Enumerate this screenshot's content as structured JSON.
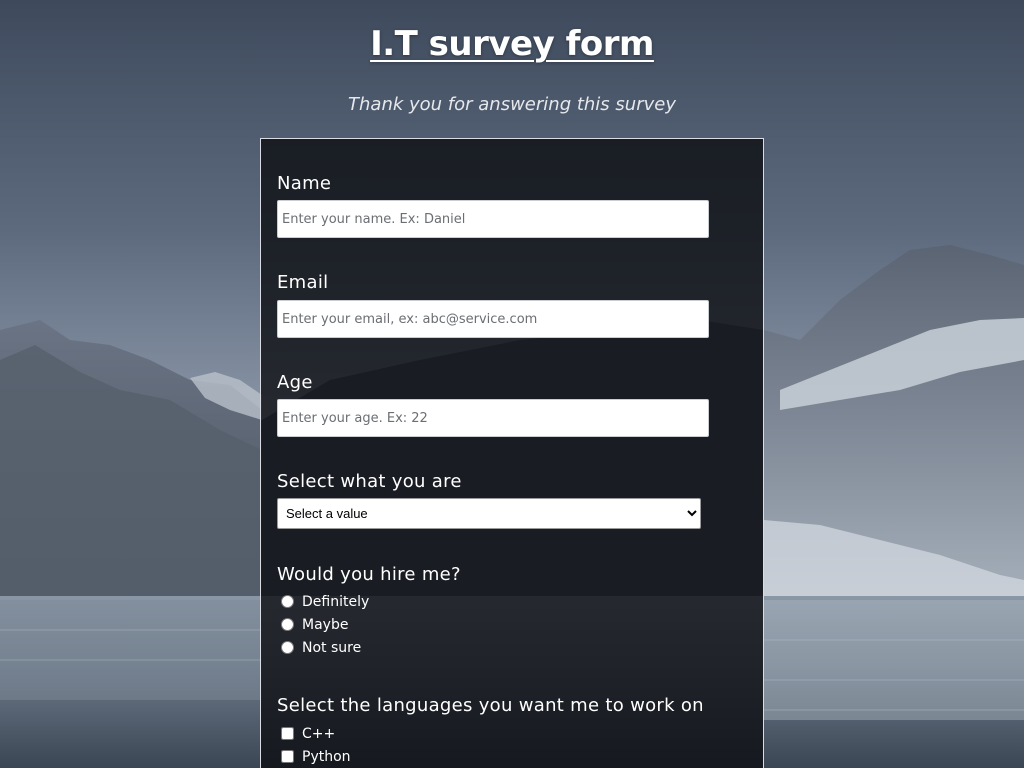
{
  "page": {
    "title": "I.T survey form",
    "subtitle": "Thank you for answering this survey"
  },
  "form": {
    "name": {
      "label": "Name",
      "placeholder": "Enter your name. Ex: Daniel",
      "value": ""
    },
    "email": {
      "label": "Email",
      "placeholder": "Enter your email, ex: abc@service.com",
      "value": ""
    },
    "age": {
      "label": "Age",
      "placeholder": "Enter your age. Ex: 22",
      "value": ""
    },
    "role": {
      "label": "Select what you are",
      "selected": "Select a value"
    },
    "hire": {
      "label": "Would you hire me?",
      "options": [
        "Definitely",
        "Maybe",
        "Not sure"
      ]
    },
    "languages": {
      "label": "Select the languages you want me to work on",
      "options": [
        "C++",
        "Python"
      ]
    }
  },
  "colors": {
    "panel_bg": "#0c0e12",
    "panel_border": "#d9dde3",
    "text": "#ffffff"
  },
  "icons": {
    "select_arrow": "chevron-down-icon"
  }
}
